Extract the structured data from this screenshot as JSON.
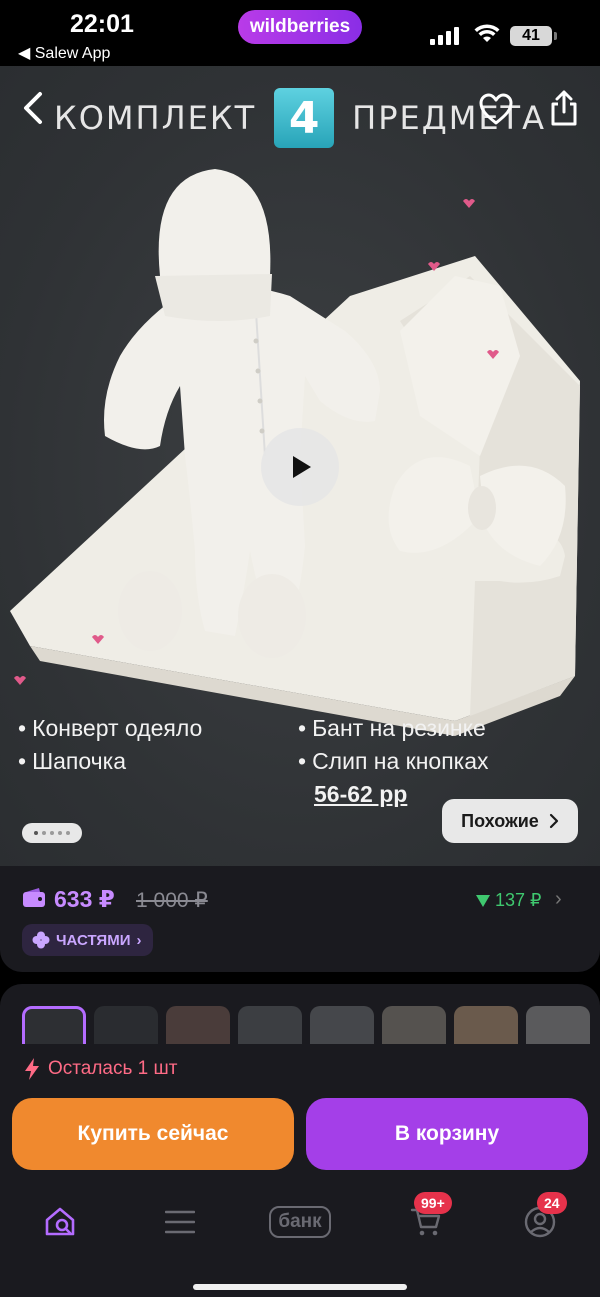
{
  "status_bar": {
    "time": "22:01",
    "back_app": "◀ Salew App",
    "brand": "wildberries",
    "battery": "41"
  },
  "hero": {
    "title_left": "КОМПЛЕКТ",
    "title_number": "4",
    "title_right": "ПРЕДМЕТА",
    "icons": [
      "back-chevron-icon",
      "heart-icon",
      "share-icon",
      "play-icon"
    ],
    "bullets_left": [
      "Конверт одеяло",
      "Шапочка"
    ],
    "bullets_right": [
      "Бант на резинке",
      "Слип на кнопках"
    ],
    "size": "56-62 рр",
    "similar_label": "Похожие",
    "slide_count": 5,
    "active_slide": 1
  },
  "price": {
    "current": "633 ₽",
    "old": "1 000 ₽",
    "delta": "137 ₽",
    "installments": "ЧАСТЯМИ"
  },
  "thumbnails": {
    "count": 8,
    "active_index": 0
  },
  "purchase": {
    "stock": "Осталась 1 шт",
    "buy_now": "Купить сейчас",
    "add_to_cart": "В корзину"
  },
  "tabbar": {
    "bank_label": "банк",
    "cart_badge": "99+",
    "profile_badge": "24"
  },
  "colors": {
    "accent_purple": "#a43fe8",
    "buy_orange": "#f0892e",
    "price_purple": "#c78bff",
    "delta_green": "#3fc86f",
    "badge_red": "#e6324b"
  }
}
